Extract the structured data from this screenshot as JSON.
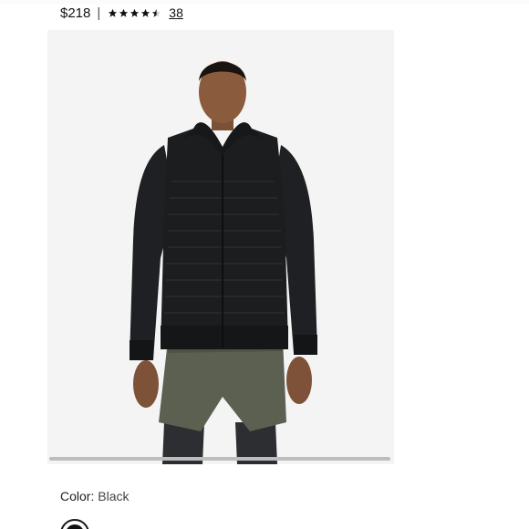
{
  "product": {
    "price": "$218",
    "separator": "|",
    "rating_value": 4.5,
    "rating_max": 5,
    "review_count": "38",
    "image_alt": "Man wearing a black quilted hooded jacket with olive shorts",
    "image_progress": 1.0
  },
  "options": {
    "color_label": "Color:",
    "color_value": "Black",
    "swatches": [
      {
        "name": "Black",
        "hex": "#111111",
        "selected": true
      }
    ]
  },
  "colors": {
    "jacket": "#1c1d1f",
    "shorts": "#5b6051",
    "skin": "#8a5b3d",
    "background": "#f4f4f4"
  }
}
